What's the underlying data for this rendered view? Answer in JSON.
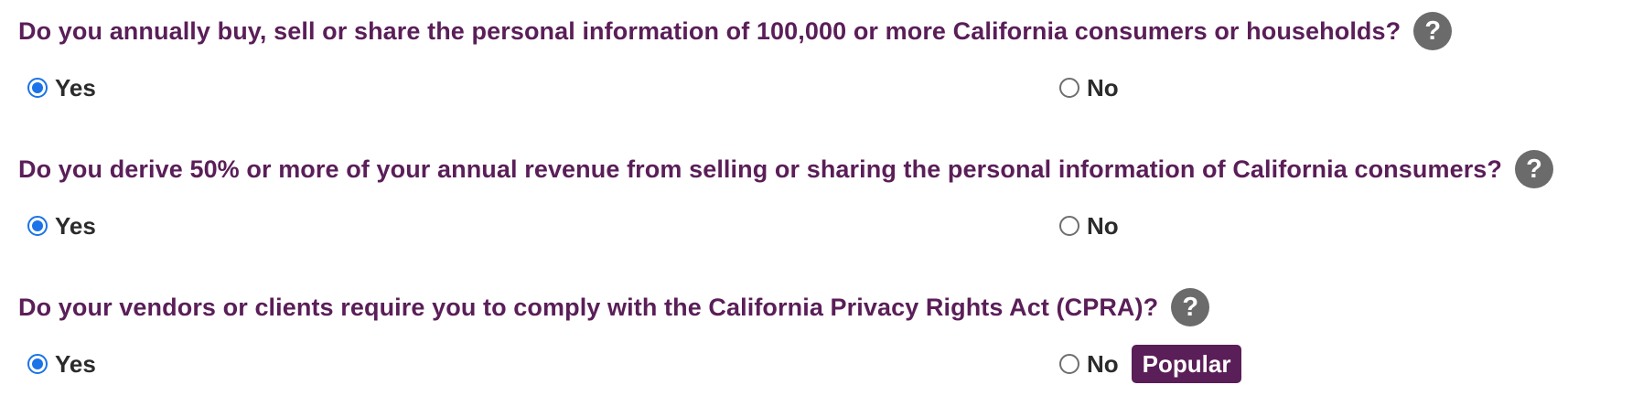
{
  "questions": [
    {
      "text": "Do you annually buy, sell or share the personal information of 100,000 or more California consumers or households?",
      "help_icon": "?",
      "options": [
        {
          "label": "Yes",
          "selected": true
        },
        {
          "label": "No",
          "selected": false
        }
      ]
    },
    {
      "text": "Do you derive 50% or more of your annual revenue from selling or sharing the personal information of California consumers?",
      "help_icon": "?",
      "options": [
        {
          "label": "Yes",
          "selected": true
        },
        {
          "label": "No",
          "selected": false
        }
      ]
    },
    {
      "text": "Do your vendors or clients require you to comply with the California Privacy Rights Act (CPRA)?",
      "help_icon": "?",
      "options": [
        {
          "label": "Yes",
          "selected": true
        },
        {
          "label": "No",
          "selected": false,
          "badge": "Popular"
        }
      ]
    }
  ],
  "colors": {
    "question_text": "#5a1e58",
    "radio_checked": "#1a73e8",
    "help_icon_bg": "#6b6b6b",
    "badge_bg": "#5a1e58"
  },
  "icons": {
    "help": "question-mark-circle",
    "radio_checked": "radio-checked",
    "radio_unchecked": "radio-unchecked"
  }
}
